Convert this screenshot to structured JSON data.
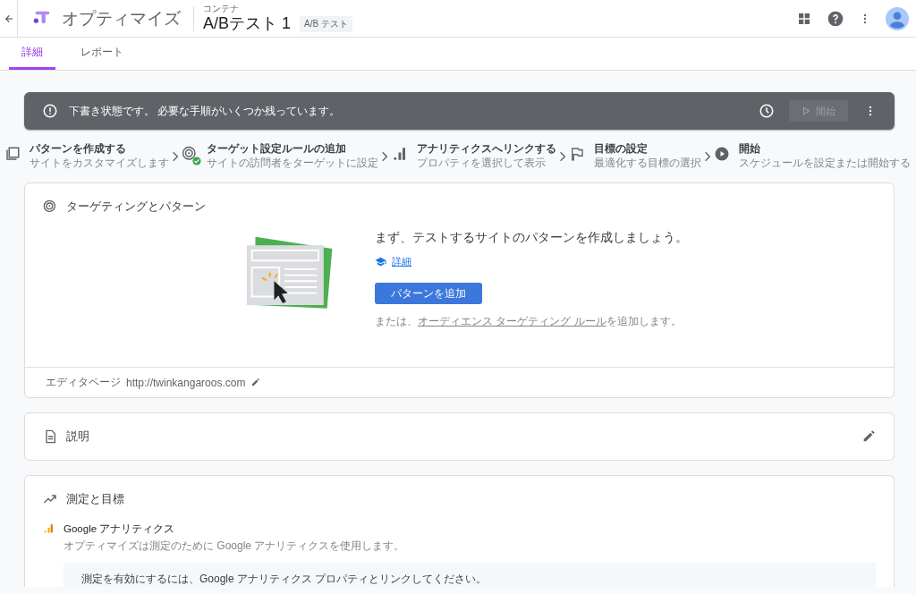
{
  "header": {
    "product": "オプティマイズ",
    "container_label": "コンテナ",
    "experiment_title": "A/Bテスト 1",
    "experiment_type": "A/B テスト"
  },
  "tabs": [
    {
      "label": "詳細",
      "selected": true
    },
    {
      "label": "レポート",
      "selected": false
    }
  ],
  "banner": {
    "message": "下書き状態です。 必要な手順がいくつか残っています。",
    "start_button": {
      "label": "開始",
      "disabled": true
    }
  },
  "steps": [
    {
      "kind": "variants",
      "title": "パターンを作成する",
      "subtitle": "サイトをカスタマイズします",
      "completed": false
    },
    {
      "kind": "targeting",
      "title": "ターゲット設定ルールの追加",
      "subtitle": "サイトの訪問者をターゲットに設定",
      "completed": true
    },
    {
      "kind": "analytics",
      "title": "アナリティクスへリンクする",
      "subtitle": "プロパティを選択して表示",
      "completed": false
    },
    {
      "kind": "objective",
      "title": "目標の設定",
      "subtitle": "最適化する目標の選択",
      "completed": false
    },
    {
      "kind": "start",
      "title": "開始",
      "subtitle": "スケジュールを設定または開始する",
      "completed": false
    }
  ],
  "targeting_card": {
    "title": "ターゲティングとパターン",
    "headline": "まず、テストするサイトのパターンを作成しましょう。",
    "learn_more": "詳細",
    "add_button": "パターンを追加",
    "alt_prefix": "または、",
    "alt_link": "オーディエンス ターゲティング ルール",
    "alt_suffix": "を追加します。",
    "editor_page_label": "エディタページ",
    "editor_page_url": "http://twinkangaroos.com"
  },
  "description_card": {
    "title": "説明"
  },
  "measurement_card": {
    "title": "測定と目標",
    "analytics_title": "Google アナリティクス",
    "analytics_subtitle": "オプティマイズは測定のために Google アナリティクスを使用します。",
    "notice": "測定を有効にするには、Google アナリティクス プロパティとリンクしてください。"
  }
}
